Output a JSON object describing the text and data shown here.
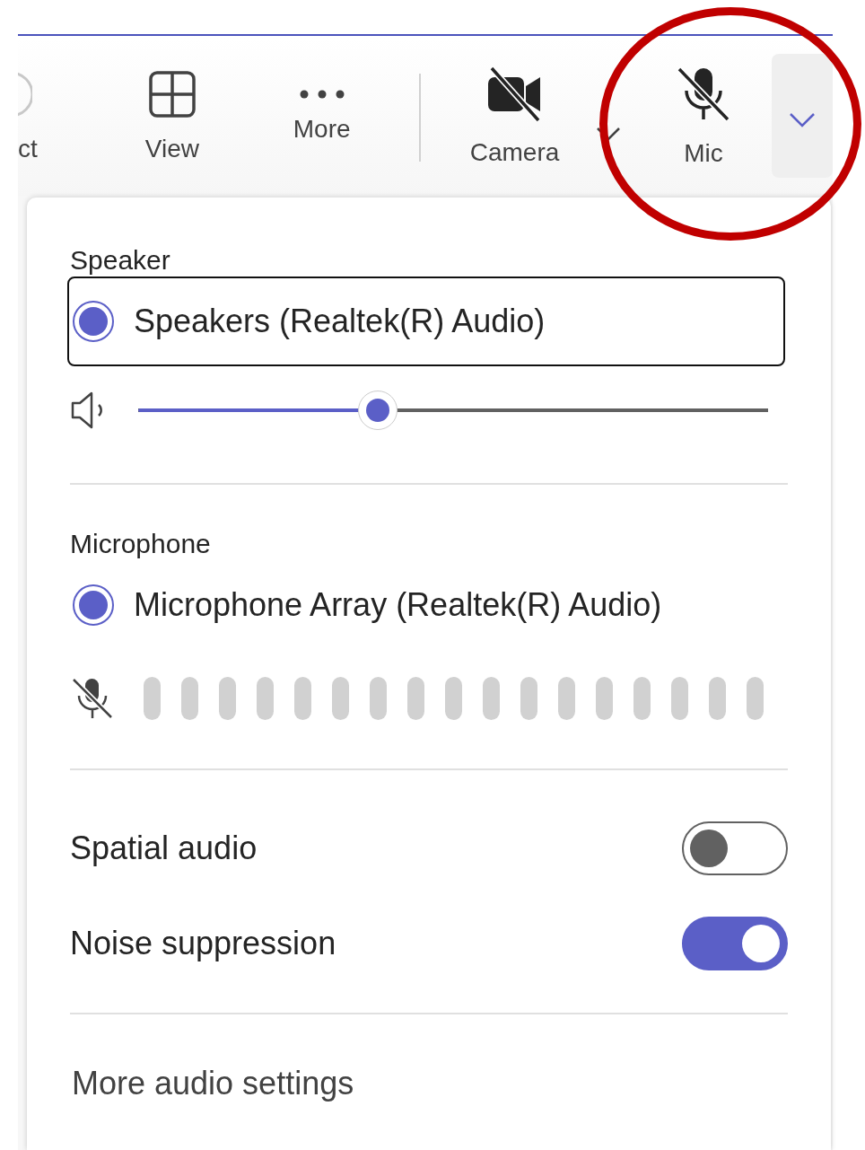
{
  "toolbar": {
    "items": [
      {
        "kind": "partial",
        "label": "ct"
      },
      {
        "kind": "view",
        "label": "View"
      },
      {
        "kind": "more",
        "label": "More"
      },
      {
        "kind": "divider"
      },
      {
        "kind": "camera",
        "label": "Camera",
        "off": true
      },
      {
        "kind": "chevron"
      },
      {
        "kind": "mic",
        "label": "Mic",
        "off": true
      },
      {
        "kind": "dropdown",
        "expanded": true
      }
    ]
  },
  "panel": {
    "speaker": {
      "heading": "Speaker",
      "devices": [
        {
          "label": "Speakers (Realtek(R) Audio)",
          "selected": true,
          "focused": true
        }
      ],
      "volume": {
        "level": 0.38
      }
    },
    "microphone": {
      "heading": "Microphone",
      "devices": [
        {
          "label": "Microphone Array (Realtek(R) Audio)",
          "selected": true,
          "focused": false
        }
      ],
      "meter": {
        "muted": true
      }
    },
    "toggles": [
      {
        "label": "Spatial audio",
        "on": false
      },
      {
        "label": "Noise suppression",
        "on": true
      }
    ],
    "link": "More audio settings"
  },
  "annotation": {
    "kind": "circle"
  }
}
